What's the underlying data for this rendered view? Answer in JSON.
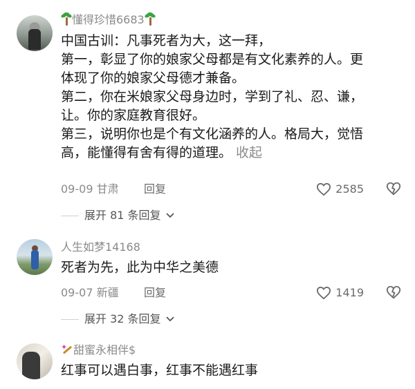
{
  "comments": [
    {
      "username": "懂得珍惜6683",
      "lines": [
        "中国古训：凡事死者为大，这一拜，",
        "第一，彰显了你的娘家父母都是有文化素养的人。更",
        "体现了你的娘家父母德才兼备。",
        "第二，你在米娘家父母身边时，学到了礼、忍、谦，",
        "让。你的家庭教育很好。",
        "第三，说明你也是个有文化涵养的人。格局大，觉悟",
        "高，能懂得有舍有得的道理。"
      ],
      "collapse_label": "收起",
      "date_location": "09-09 甘肃",
      "reply_label": "回复",
      "likes": "2585",
      "expand_label": "展开 81 条回复"
    },
    {
      "username": "人生如梦14168",
      "lines": [
        "死者为先，此为中华之美德"
      ],
      "date_location": "09-07 新疆",
      "reply_label": "回复",
      "likes": "1419",
      "expand_label": "展开 32 条回复"
    },
    {
      "username": "甜蜜永相伴$",
      "lines": [
        "红事可以遇白事，红事不能遇红事"
      ]
    }
  ],
  "icons": {
    "like": "heart-outline-icon",
    "dislike": "broken-heart-icon",
    "expand": "chevron-down-icon",
    "badge_palm": "palm-tree-icon",
    "badge_wand": "magic-wand-icon"
  }
}
